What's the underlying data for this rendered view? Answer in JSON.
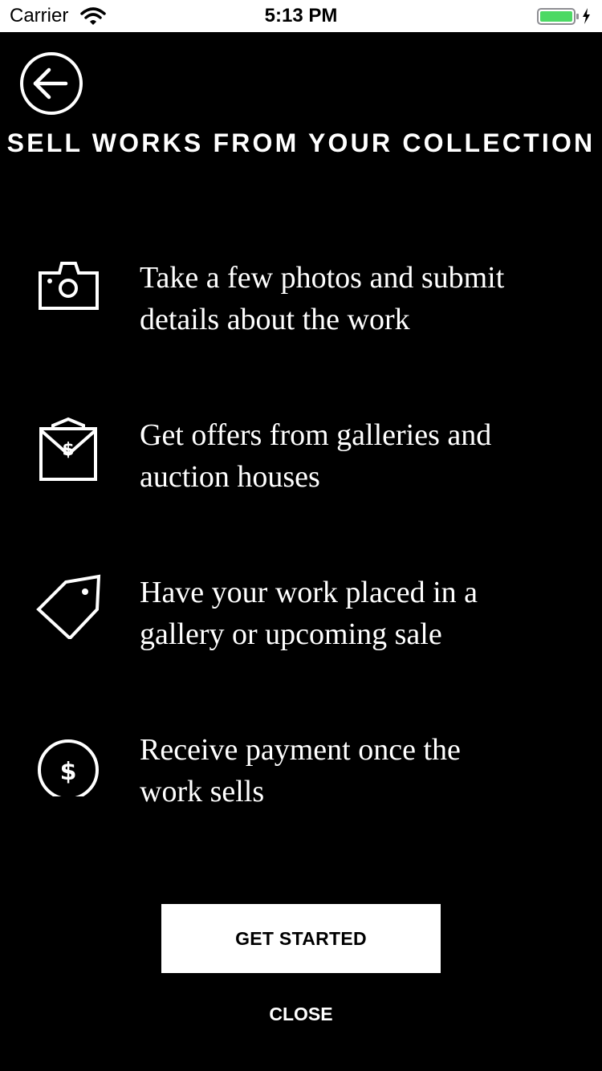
{
  "status_bar": {
    "carrier": "Carrier",
    "time": "5:13 PM",
    "wifi_icon": "wifi-icon",
    "battery_icon": "battery-charging-icon",
    "battery_color": "#4cd964"
  },
  "header": {
    "back_icon": "arrow-left-icon",
    "title": "SELL WORKS FROM YOUR COLLECTION"
  },
  "steps": [
    {
      "icon": "camera-icon",
      "line1": "Take a few photos and submit",
      "line2": "details about the work"
    },
    {
      "icon": "envelope-dollar-icon",
      "line1": "Get offers from galleries and",
      "line2": "auction houses"
    },
    {
      "icon": "price-tag-icon",
      "line1": "Have your work placed in a",
      "line2": "gallery or upcoming sale"
    },
    {
      "icon": "dollar-coin-icon",
      "line1": "Receive payment once the",
      "line2": "work sells"
    }
  ],
  "actions": {
    "primary_label": "GET STARTED",
    "secondary_label": "CLOSE"
  },
  "colors": {
    "background": "#000000",
    "foreground": "#ffffff"
  }
}
